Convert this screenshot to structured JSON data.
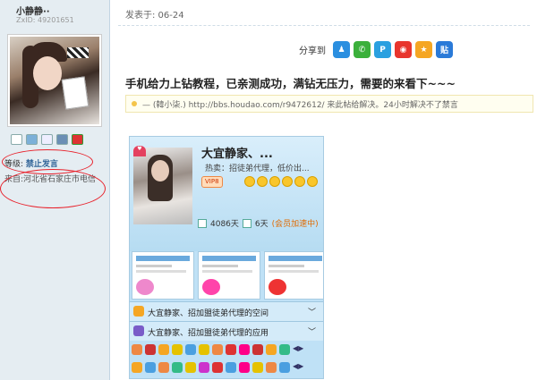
{
  "user": {
    "name": "小静静··",
    "uid": "ZxID: 49201651",
    "level_label": "等级:",
    "level_value": "禁止发言",
    "from": "来自:河北省石家庄市电信"
  },
  "post": {
    "posted_at": "发表于: 06-24",
    "share_label": "分享到",
    "share_icons": [
      "qq-icon",
      "wechat-icon",
      "qzone-icon",
      "weibo-icon",
      "favorite-star-icon",
      "tieba-icon"
    ],
    "share_glyphs": [
      "♟",
      "✆",
      "P",
      "◉",
      "★",
      "贴"
    ],
    "share_colors": [
      "#2b8fe0",
      "#3bb03b",
      "#2aa0e0",
      "#e8352d",
      "#f5a623",
      "#2a7ad8"
    ],
    "title": "手机给力上钻教程，已亲测成功，满钻无压力，需要的来看下~~~",
    "note": "— (韓小柒.) http://bbs.houdao.com/r9472612/   来此帖给解决。24小时解决不了禁言"
  },
  "zone": {
    "name": "大宜静家、...",
    "hot": "热卖：招徒弟代理，低价出...",
    "vip": "VIP8",
    "days1": "4086天",
    "days2": "6天",
    "days2_note": "(会员加速中)",
    "space_row": "大宜静家、招加盟徒弟代理的空间",
    "apps_row": "大宜静家、招加盟徒弟代理的应用",
    "accent": "#e8202a"
  }
}
